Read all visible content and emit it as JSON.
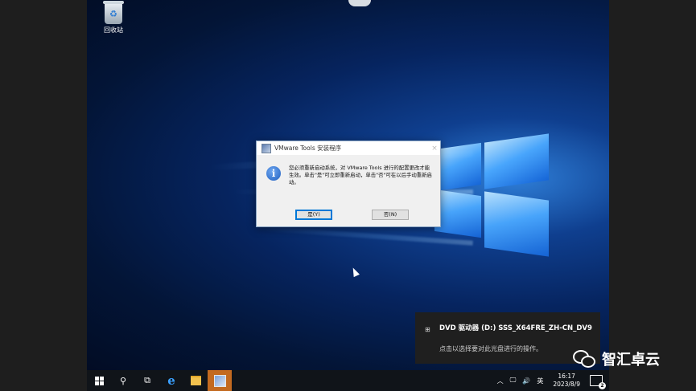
{
  "desktop": {
    "recycle_bin_label": "回收站"
  },
  "dialog": {
    "title": "VMware Tools 安装程序",
    "close_glyph": "×",
    "info_glyph": "i",
    "message": "您必须重新启动系统，对 VMware Tools 进行的配置更改才能生效。单击\"是\"可立即重新启动，单击\"否\"可在以后手动重新启动。",
    "yes_label": "是(Y)",
    "no_label": "否(N)"
  },
  "toast": {
    "title": "DVD 驱动器 (D:) SSS_X64FRE_ZH-CN_DV9",
    "subtitle": "点击以选择要对此光盘进行的操作。",
    "icon": "dvd-drive-icon",
    "icon_glyph": "⊞"
  },
  "taskbar": {
    "search_glyph": "⚲",
    "taskview_glyph": "⧉",
    "ie_glyph": "e",
    "tray": {
      "chevron": "︿",
      "network_glyph": "🖵",
      "volume_glyph": "🔊",
      "ime": "英",
      "time": "16:17",
      "date": "2023/8/9",
      "notification_count": "2"
    }
  },
  "watermark": {
    "text": "智汇卓云"
  }
}
